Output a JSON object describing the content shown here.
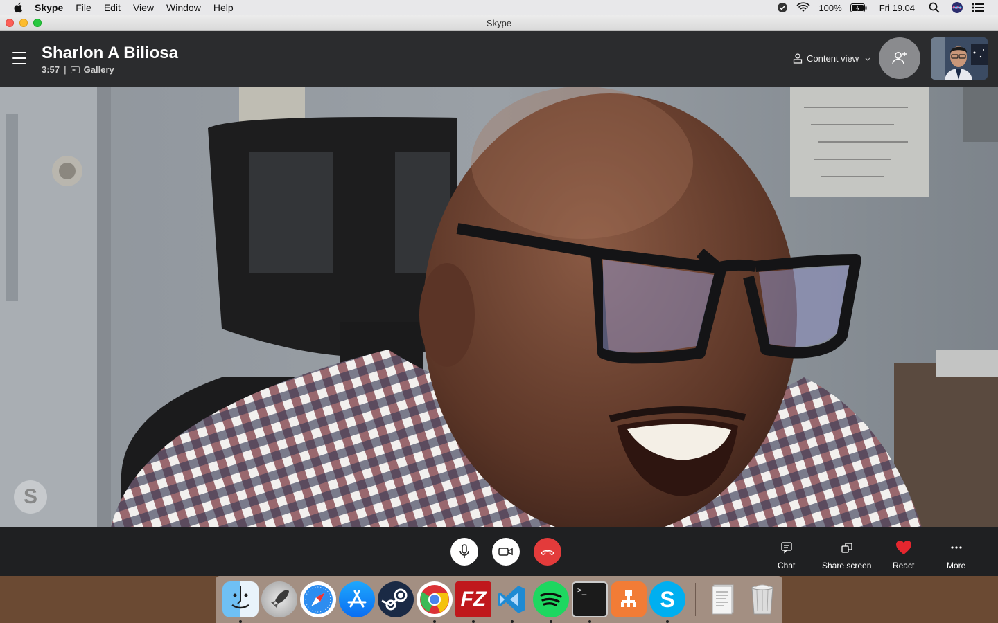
{
  "menubar": {
    "app_name": "Skype",
    "items": [
      "File",
      "Edit",
      "View",
      "Window",
      "Help"
    ],
    "battery": "100%",
    "clock": "Fri 19.04"
  },
  "window": {
    "title": "Skype"
  },
  "call": {
    "caller_name": "Sharlon A Biliosa",
    "duration": "3:57",
    "separator": "|",
    "view_mode": "Gallery",
    "content_view_label": "Content view",
    "skype_logo_letter": "S"
  },
  "actions": {
    "chat": "Chat",
    "share_screen": "Share screen",
    "react": "React",
    "more": "More"
  },
  "colors": {
    "header_bg": "#2b2c2e",
    "controls_bg": "#1f2022",
    "hangup": "#e33b3b",
    "react_heart": "#e4262e"
  },
  "dock": {
    "apps": [
      "finder-icon",
      "launchpad-icon",
      "safari-icon",
      "app-store-icon",
      "steam-icon",
      "chrome-icon",
      "filezilla-icon",
      "vscode-icon",
      "spotify-icon",
      "terminal-icon",
      "sourcetree-icon",
      "skype-icon"
    ],
    "filezilla_label": "FZ",
    "terminal_prompt": ">_",
    "skype_letter": "S"
  }
}
